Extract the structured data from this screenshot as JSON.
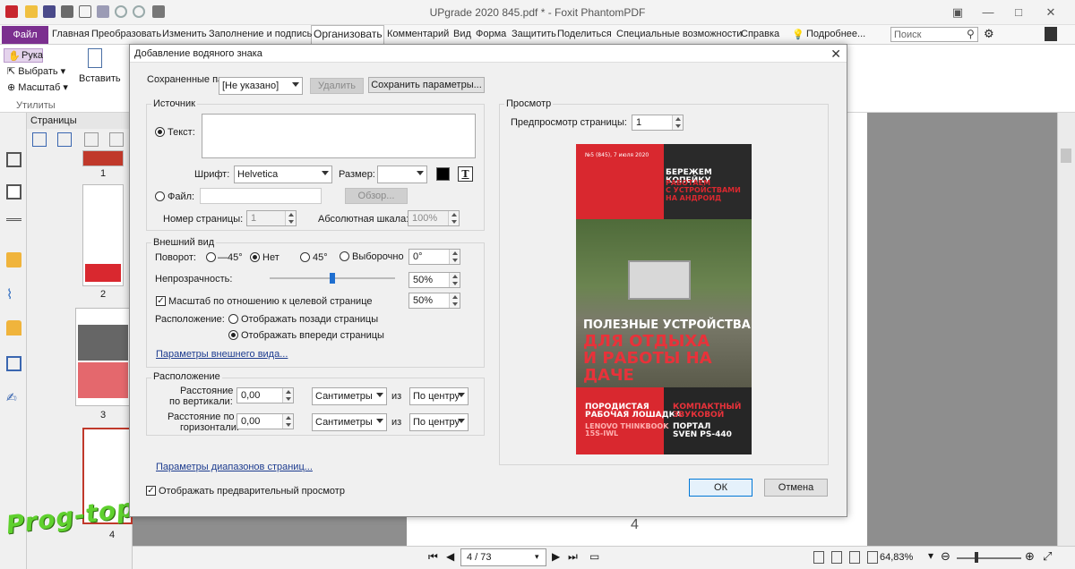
{
  "app": {
    "title": "UPgrade 2020 845.pdf * - Foxit PhantomPDF"
  },
  "menu": {
    "file": "Файл",
    "items": [
      "Главная",
      "Преобразовать",
      "Изменить",
      "Заполнение и подпись",
      "Организовать",
      "Комментарий",
      "Вид",
      "Форма",
      "Защитить",
      "Поделиться",
      "Специальные возможности",
      "Справка"
    ],
    "active": "Организовать",
    "more": "Подробнее...",
    "search_placeholder": "Поиск"
  },
  "ribbon": {
    "hand": "Рука",
    "select": "Выбрать",
    "zoom": "Масштаб",
    "insert": "Вставить",
    "utilities": "Утилиты"
  },
  "pages_panel": {
    "title": "Страницы",
    "page_numbers": [
      "1",
      "2",
      "3",
      "4"
    ]
  },
  "status": {
    "page": "4 / 73",
    "zoom": "64,83%",
    "doc_page_number": "4"
  },
  "site_watermark": "Prog-top.net",
  "dialog": {
    "title": "Добавление водяного знака",
    "saved_params_label": "Сохраненные параметры:",
    "saved_params_value": "[Не указано]",
    "delete_btn": "Удалить",
    "save_params_btn": "Сохранить параметры...",
    "source": {
      "title": "Источник",
      "text_radio": "Текст:",
      "font_label": "Шрифт:",
      "font_value": "Helvetica",
      "size_label": "Размер:",
      "size_value": "",
      "file_radio": "Файл:",
      "browse_btn": "Обзор...",
      "page_number_label": "Номер страницы:",
      "page_number_value": "1",
      "abs_scale_label": "Абсолютная шкала:",
      "abs_scale_value": "100%"
    },
    "appearance": {
      "title": "Внешний вид",
      "rotation_label": "Поворот:",
      "rot_m45": "—45°",
      "rot_none": "Нет",
      "rot_45": "45°",
      "rot_custom": "Выборочно",
      "rot_value": "0°",
      "opacity_label": "Непрозрачность:",
      "opacity_value": "50%",
      "opacity_level": 0.5,
      "scale_checkbox": "Масштаб по отношению к целевой странице",
      "scale_value": "50%",
      "location_label": "Расположение:",
      "behind": "Отображать позади страницы",
      "front": "Отображать впереди страницы",
      "link": "Параметры внешнего вида..."
    },
    "position": {
      "title": "Расположение",
      "vert_label_1": "Расстояние",
      "vert_label_2": "по вертикали:",
      "vert_value": "0,00",
      "vert_unit": "Сантиметры",
      "from": "из",
      "vert_from": "По центру",
      "horiz_label_1": "Расстояние по",
      "horiz_label_2": "горизонтали:",
      "horiz_value": "0,00",
      "horiz_unit": "Сантиметры",
      "horiz_from": "По центру"
    },
    "page_range_link": "Параметры диапазонов страниц...",
    "show_preview": "Отображать предварительный просмотр",
    "preview": {
      "title": "Просмотр",
      "page_preview_label": "Предпросмотр страницы:",
      "page_preview_value": "1",
      "cover": {
        "issue": "№5 (845), 7 июля 2020",
        "headline_top": "БЕРЕЖЕМ КОПЕЙКУ",
        "sub_top": "РАБОТАЕМ\nС УСТРОЙСТВАМИ\nНА АНДРОИД",
        "main_white": "ПОЛЕЗНЫЕ УСТРОЙСТВА",
        "main_red": "ДЛЯ ОТДЫХА\nИ РАБОТЫ НА ДАЧЕ",
        "bl_white": "ПОРОДИСТАЯ\nРАБОЧАЯ ЛОШАДКА",
        "bl_red": "LENOVO THINKBOOK\n15S-IWL",
        "br_red": "КОМПАКТНЫЙ\nЗВУКОВОЙ",
        "br_white": "ПОРТАЛ\nSVEN PS-440"
      }
    },
    "ok": "ОК",
    "cancel": "Отмена"
  },
  "colors": {
    "file_tab": "#7b2f8f",
    "link": "#1d3c8f",
    "accent": "#1f6fd0",
    "cover_red": "#d9282f"
  }
}
